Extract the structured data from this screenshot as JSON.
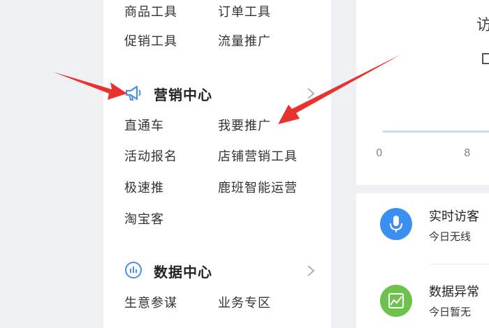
{
  "sidebar": {
    "top_items": [
      [
        "商品工具",
        "订单工具"
      ],
      [
        "促销工具",
        "流量推广"
      ]
    ],
    "marketing": {
      "title": "营销中心",
      "icon": "megaphone-icon",
      "items": [
        [
          "直通车",
          "我要推广"
        ],
        [
          "活动报名",
          "店铺营销工具"
        ],
        [
          "极速推",
          "鹿班智能运营"
        ],
        [
          "淘宝客",
          ""
        ]
      ]
    },
    "data_center": {
      "title": "数据中心",
      "icon": "bar-chart-icon",
      "items": [
        [
          "生意参谋",
          "业务专区"
        ]
      ]
    }
  },
  "right_panel": {
    "visit_label": "访",
    "axis_ticks": [
      "0",
      "8"
    ],
    "notices": [
      {
        "icon": "microphone-icon",
        "title": "实时访客",
        "subtitle": "今日无线",
        "color": "#3b8ff0"
      },
      {
        "icon": "chart-image-icon",
        "title": "数据异常",
        "subtitle": "今日暂无",
        "color": "#6cc24a"
      }
    ]
  },
  "colors": {
    "arrow": "#e8322e",
    "section_icon": "#4a8fe7",
    "background": "#eef0f4"
  }
}
